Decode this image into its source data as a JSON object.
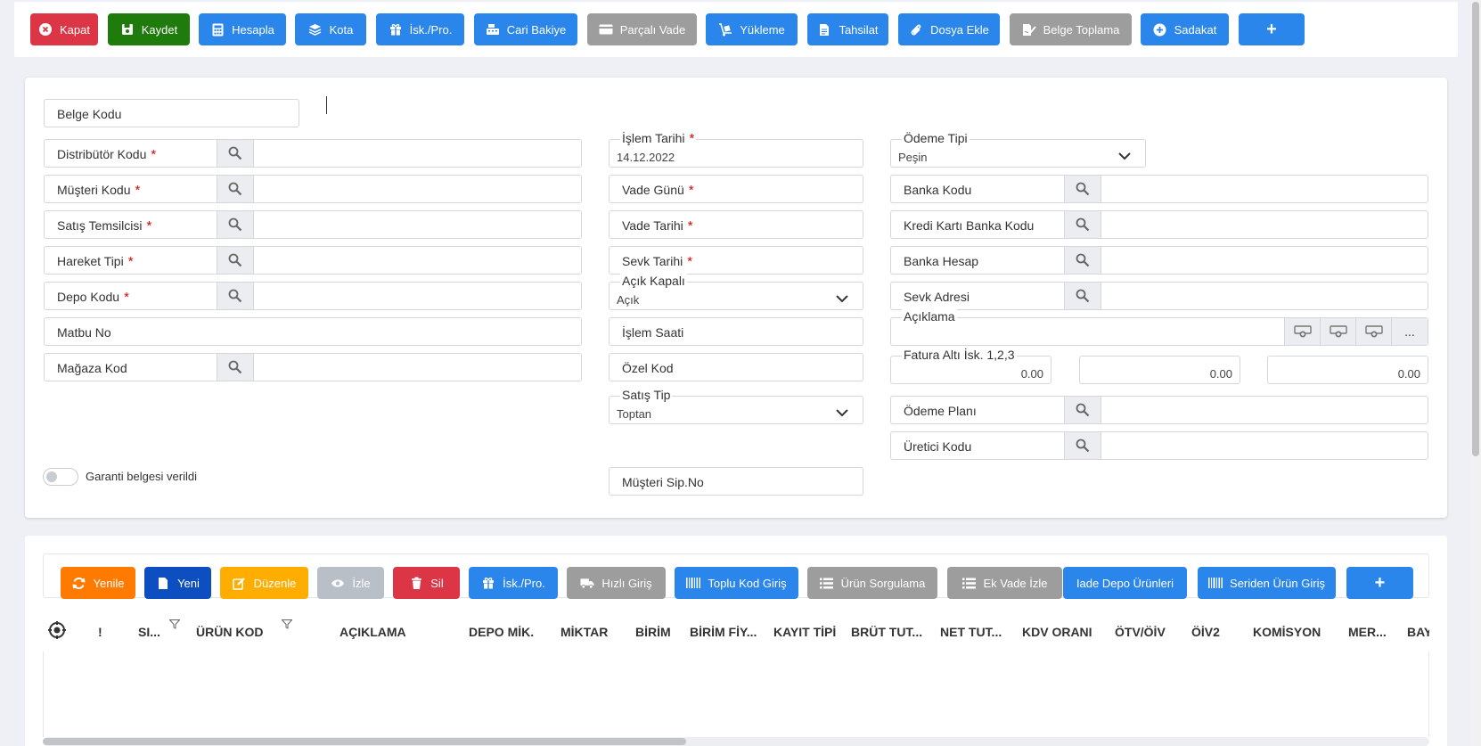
{
  "toolbar": {
    "buttons": [
      {
        "label": "Kapat",
        "icon": "close-circle-icon"
      },
      {
        "label": "Kaydet",
        "icon": "save-icon"
      },
      {
        "label": "Hesapla",
        "icon": "calculator-icon"
      },
      {
        "label": "Kota",
        "icon": "layers-icon"
      },
      {
        "label": "İsk./Pro.",
        "icon": "gift-icon"
      },
      {
        "label": "Cari Bakiye",
        "icon": "cash-register-icon"
      },
      {
        "label": "Parçalı Vade",
        "icon": "credit-card-icon"
      },
      {
        "label": "Yükleme",
        "icon": "dolly-icon"
      },
      {
        "label": "Tahsilat",
        "icon": "document-icon"
      },
      {
        "label": "Dosya Ekle",
        "icon": "paperclip-icon"
      },
      {
        "label": "Belge Toplama",
        "icon": "sign-document-icon"
      },
      {
        "label": "Sadakat",
        "icon": "plus-circle-icon"
      },
      {
        "label": "+",
        "icon": "plus-icon"
      }
    ]
  },
  "form": {
    "belge_kodu": "Belge Kodu",
    "distributor_kodu": "Distribütör Kodu",
    "musteri_kodu": "Müşteri Kodu",
    "satis_temsilcisi": "Satış Temsilcisi",
    "hareket_tipi": "Hareket Tipi",
    "depo_kodu": "Depo Kodu",
    "matbu_no": "Matbu No",
    "magaza_kod": "Mağaza Kod",
    "islem_tarihi": {
      "label": "İşlem Tarihi",
      "value": "14.12.2022"
    },
    "vade_gunu": "Vade Günü",
    "vade_tarihi": "Vade Tarihi",
    "sevk_tarihi": "Sevk Tarihi",
    "acik_kapali": {
      "label": "Açık Kapalı",
      "value": "Açık"
    },
    "islem_saati": "İşlem Saati",
    "ozel_kod": "Özel Kod",
    "satis_tip": {
      "label": "Satış Tip",
      "value": "Toptan"
    },
    "musteri_sip_no": "Müşteri Sip.No",
    "odeme_tipi": {
      "label": "Ödeme Tipi",
      "value": "Peşin"
    },
    "banka_kodu": "Banka Kodu",
    "kredi_karti_banka_kodu": "Kredi Kartı Banka Kodu",
    "banka_hesap": "Banka Hesap",
    "sevk_adresi": "Sevk Adresi",
    "aciklama": {
      "label": "Açıklama",
      "more": "..."
    },
    "fatura_alti_isk": {
      "label": "Fatura Altı İsk. 1,2,3",
      "values": [
        "0.00",
        "0.00",
        "0.00"
      ]
    },
    "odeme_plani": "Ödeme Planı",
    "uretici_kodu": "Üretici Kodu",
    "garanti_label": "Garanti belgesi verildi",
    "required_mark": "*"
  },
  "grid_toolbar": {
    "buttons": [
      {
        "label": "Yenile",
        "icon": "refresh-icon"
      },
      {
        "label": "Yeni",
        "icon": "new-document-icon"
      },
      {
        "label": "Düzenle",
        "icon": "edit-icon"
      },
      {
        "label": "İzle",
        "icon": "eye-icon"
      },
      {
        "label": "Sil",
        "icon": "trash-icon"
      },
      {
        "label": "İsk./Pro.",
        "icon": "gift-icon"
      },
      {
        "label": "Hızlı Giriş",
        "icon": "truck-icon"
      },
      {
        "label": "Toplu Kod Giriş",
        "icon": "barcode-icon"
      },
      {
        "label": "Ürün Sorgulama",
        "icon": "list-icon"
      },
      {
        "label": "Ek Vade İzle",
        "icon": "list-icon"
      },
      {
        "label": "Iade Depo Ürünleri",
        "icon": ""
      },
      {
        "label": "Seriden Ürün Giriş",
        "icon": "barcode-icon"
      },
      {
        "label": "+",
        "icon": "plus-icon"
      }
    ]
  },
  "grid": {
    "columns": [
      "!",
      "SI...",
      "ÜRÜN KOD",
      "AÇIKLAMA",
      "DEPO MİK.",
      "MİKTAR",
      "BİRİM",
      "BİRİM FİY...",
      "KAYIT TİPİ",
      "BRÜT TUT...",
      "NET TUT...",
      "KDV ORANI",
      "ÖTV/ÖİV",
      "ÖİV2",
      "KOMİSYON",
      "MER...",
      "BAY"
    ]
  },
  "colors": {
    "primary": "#2b86ec",
    "danger": "#dc3545",
    "success": "#1e7b0c",
    "neutral": "#9d9d9d",
    "required": "#e00000"
  }
}
